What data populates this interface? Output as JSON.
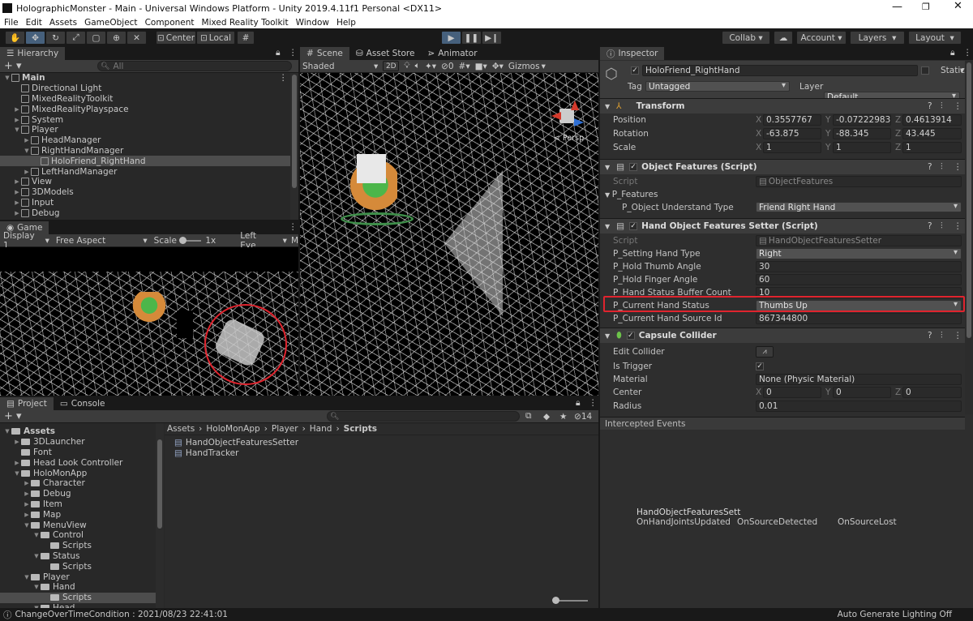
{
  "window": {
    "title": "HolographicMonster - Main - Universal Windows Platform - Unity 2019.4.11f1 Personal <DX11>"
  },
  "menu": [
    "File",
    "Edit",
    "Assets",
    "GameObject",
    "Component",
    "Mixed Reality Toolkit",
    "Window",
    "Help"
  ],
  "toolbar": {
    "center": "Center",
    "local": "Local",
    "collab": "Collab",
    "account": "Account",
    "layers": "Layers",
    "layout": "Layout"
  },
  "hierarchy": {
    "tab": "Hierarchy",
    "search_placeholder": "All",
    "items": [
      {
        "label": "Main",
        "depth": 0,
        "arrow": "down",
        "icon": "scene"
      },
      {
        "label": "Directional Light",
        "depth": 1,
        "arrow": "",
        "icon": "go"
      },
      {
        "label": "MixedRealityToolkit",
        "depth": 1,
        "arrow": "",
        "icon": "go"
      },
      {
        "label": "MixedRealityPlayspace",
        "depth": 1,
        "arrow": "right",
        "icon": "go"
      },
      {
        "label": "System",
        "depth": 1,
        "arrow": "right",
        "icon": "go"
      },
      {
        "label": "Player",
        "depth": 1,
        "arrow": "down",
        "icon": "go"
      },
      {
        "label": "HeadManager",
        "depth": 2,
        "arrow": "right",
        "icon": "go"
      },
      {
        "label": "RightHandManager",
        "depth": 2,
        "arrow": "down",
        "icon": "go"
      },
      {
        "label": "HoloFriend_RightHand",
        "depth": 3,
        "arrow": "",
        "icon": "go",
        "selected": true
      },
      {
        "label": "LeftHandManager",
        "depth": 2,
        "arrow": "right",
        "icon": "go"
      },
      {
        "label": "View",
        "depth": 1,
        "arrow": "right",
        "icon": "go"
      },
      {
        "label": "3DModels",
        "depth": 1,
        "arrow": "right",
        "icon": "go"
      },
      {
        "label": "Input",
        "depth": 1,
        "arrow": "right",
        "icon": "go"
      },
      {
        "label": "Debug",
        "depth": 1,
        "arrow": "right",
        "icon": "go"
      }
    ]
  },
  "game": {
    "tab": "Game",
    "display": "Display 1",
    "aspect": "Free Aspect",
    "scale_label": "Scale",
    "scale_value": "1x",
    "eye": "Left Eye",
    "trunc": "M"
  },
  "scene": {
    "tabs": [
      "Scene",
      "Asset Store",
      "Animator"
    ],
    "shading": "Shaded",
    "mode2d": "2D",
    "fx_count": "0",
    "gizmos": "Gizmos",
    "persp": "< Persp"
  },
  "inspector": {
    "tab": "Inspector",
    "object_name": "HoloFriend_RightHand",
    "static_label": "Static",
    "tag_label": "Tag",
    "tag_value": "Untagged",
    "layer_label": "Layer",
    "layer_value": "Default",
    "transform": {
      "title": "Transform",
      "rows": [
        {
          "label": "Position",
          "x": "0.3557767",
          "y": "-0.07222983",
          "z": "0.4613914"
        },
        {
          "label": "Rotation",
          "x": "-63.875",
          "y": "-88.345",
          "z": "43.445"
        },
        {
          "label": "Scale",
          "x": "1",
          "y": "1",
          "z": "1"
        }
      ]
    },
    "object_features": {
      "title": "Object Features (Script)",
      "script_label": "Script",
      "script_value": "ObjectFeatures",
      "group": "P_Features",
      "type_label": "P_Object Understand Type",
      "type_value": "Friend Right Hand"
    },
    "hand_setter": {
      "title": "Hand Object Features Setter (Script)",
      "script_label": "Script",
      "script_value": "HandObjectFeaturesSetter",
      "rows": [
        {
          "label": "P_Setting Hand Type",
          "value": "Right",
          "kind": "dropdown"
        },
        {
          "label": "P_Hold Thumb Angle",
          "value": "30",
          "kind": "field"
        },
        {
          "label": "P_Hold Finger Angle",
          "value": "60",
          "kind": "field"
        },
        {
          "label": "P_Hand Status Buffer Count",
          "value": "10",
          "kind": "field"
        },
        {
          "label": "P_Current Hand Status",
          "value": "Thumbs Up",
          "kind": "dropdown",
          "highlight": true
        },
        {
          "label": "P_Current Hand Source Id",
          "value": "867344800",
          "kind": "field"
        }
      ]
    },
    "capsule": {
      "title": "Capsule Collider",
      "edit_label": "Edit Collider",
      "trigger_label": "Is Trigger",
      "material_label": "Material",
      "material_value": "None (Physic Material)",
      "center_label": "Center",
      "cx": "0",
      "cy": "0",
      "cz": "0",
      "radius_label": "Radius",
      "radius_value": "0.01"
    },
    "events": {
      "title": "Intercepted Events",
      "node": "HandObjectFeaturesSett",
      "items": [
        "OnHandJointsUpdated",
        "OnSourceDetected",
        "OnSourceLost"
      ]
    }
  },
  "project": {
    "tabs": [
      "Project",
      "Console"
    ],
    "count": "14",
    "tree": [
      {
        "label": "Assets",
        "depth": 0,
        "arrow": "down",
        "bold": true
      },
      {
        "label": "3DLauncher",
        "depth": 1,
        "arrow": "right"
      },
      {
        "label": "Font",
        "depth": 1,
        "arrow": ""
      },
      {
        "label": "Head Look Controller",
        "depth": 1,
        "arrow": "right"
      },
      {
        "label": "HoloMonApp",
        "depth": 1,
        "arrow": "down"
      },
      {
        "label": "Character",
        "depth": 2,
        "arrow": "right"
      },
      {
        "label": "Debug",
        "depth": 2,
        "arrow": "right"
      },
      {
        "label": "Item",
        "depth": 2,
        "arrow": "right"
      },
      {
        "label": "Map",
        "depth": 2,
        "arrow": "right"
      },
      {
        "label": "MenuView",
        "depth": 2,
        "arrow": "down"
      },
      {
        "label": "Control",
        "depth": 3,
        "arrow": "down"
      },
      {
        "label": "Scripts",
        "depth": 4,
        "arrow": ""
      },
      {
        "label": "Status",
        "depth": 3,
        "arrow": "down"
      },
      {
        "label": "Scripts",
        "depth": 4,
        "arrow": ""
      },
      {
        "label": "Player",
        "depth": 2,
        "arrow": "down"
      },
      {
        "label": "Hand",
        "depth": 3,
        "arrow": "down"
      },
      {
        "label": "Scripts",
        "depth": 4,
        "arrow": "",
        "selected": true
      },
      {
        "label": "Head",
        "depth": 3,
        "arrow": "down"
      }
    ],
    "breadcrumb": [
      "Assets",
      "HoloMonApp",
      "Player",
      "Hand",
      "Scripts"
    ],
    "files": [
      "HandObjectFeaturesSetter",
      "HandTracker"
    ]
  },
  "status": {
    "left": "ChangeOverTimeCondition : 2021/08/23 22:41:01",
    "right": "Auto Generate Lighting Off"
  },
  "colors": {
    "highlight": "#e0242e",
    "accent": "#46607c"
  }
}
